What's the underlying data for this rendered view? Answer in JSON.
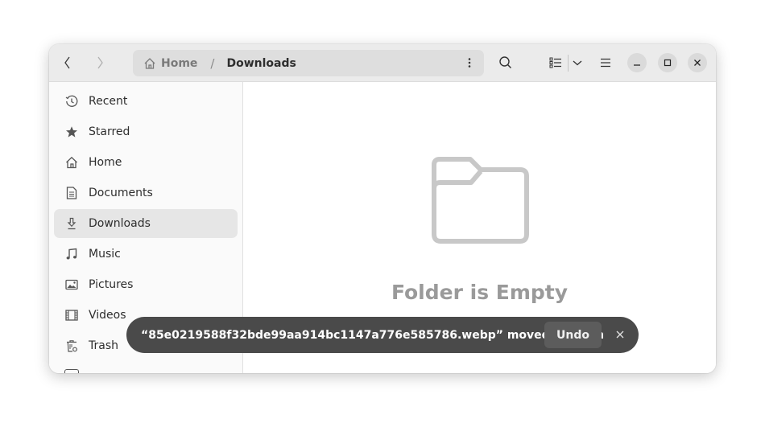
{
  "window": {
    "pathbar": {
      "home_label": "Home",
      "separator": "/",
      "current_label": "Downloads"
    },
    "icons": {
      "back": "chevron-left-icon",
      "forward": "chevron-right-icon",
      "path_menu": "vertical-dots-icon",
      "search": "search-icon",
      "view_list": "list-view-icon",
      "view_options": "chevron-down-icon",
      "main_menu": "hamburger-menu-icon",
      "minimize": "minimize-icon",
      "maximize": "maximize-icon",
      "close": "close-icon"
    }
  },
  "sidebar": {
    "items": [
      {
        "label": "Recent",
        "icon": "clock-icon",
        "active": false
      },
      {
        "label": "Starred",
        "icon": "star-icon",
        "active": false
      },
      {
        "label": "Home",
        "icon": "home-icon",
        "active": false
      },
      {
        "label": "Documents",
        "icon": "document-icon",
        "active": false
      },
      {
        "label": "Downloads",
        "icon": "download-icon",
        "active": true
      },
      {
        "label": "Music",
        "icon": "music-icon",
        "active": false
      },
      {
        "label": "Pictures",
        "icon": "picture-icon",
        "active": false
      },
      {
        "label": "Videos",
        "icon": "film-icon",
        "active": false
      },
      {
        "label": "Trash",
        "icon": "trash-icon",
        "active": false
      }
    ]
  },
  "content": {
    "empty_icon": "folder-icon",
    "empty_title": "Folder is Empty"
  },
  "toast": {
    "message": "“85e0219588f32bde99aa914bc1147a776e585786.webp” moved to trash",
    "undo_label": "Undo"
  }
}
